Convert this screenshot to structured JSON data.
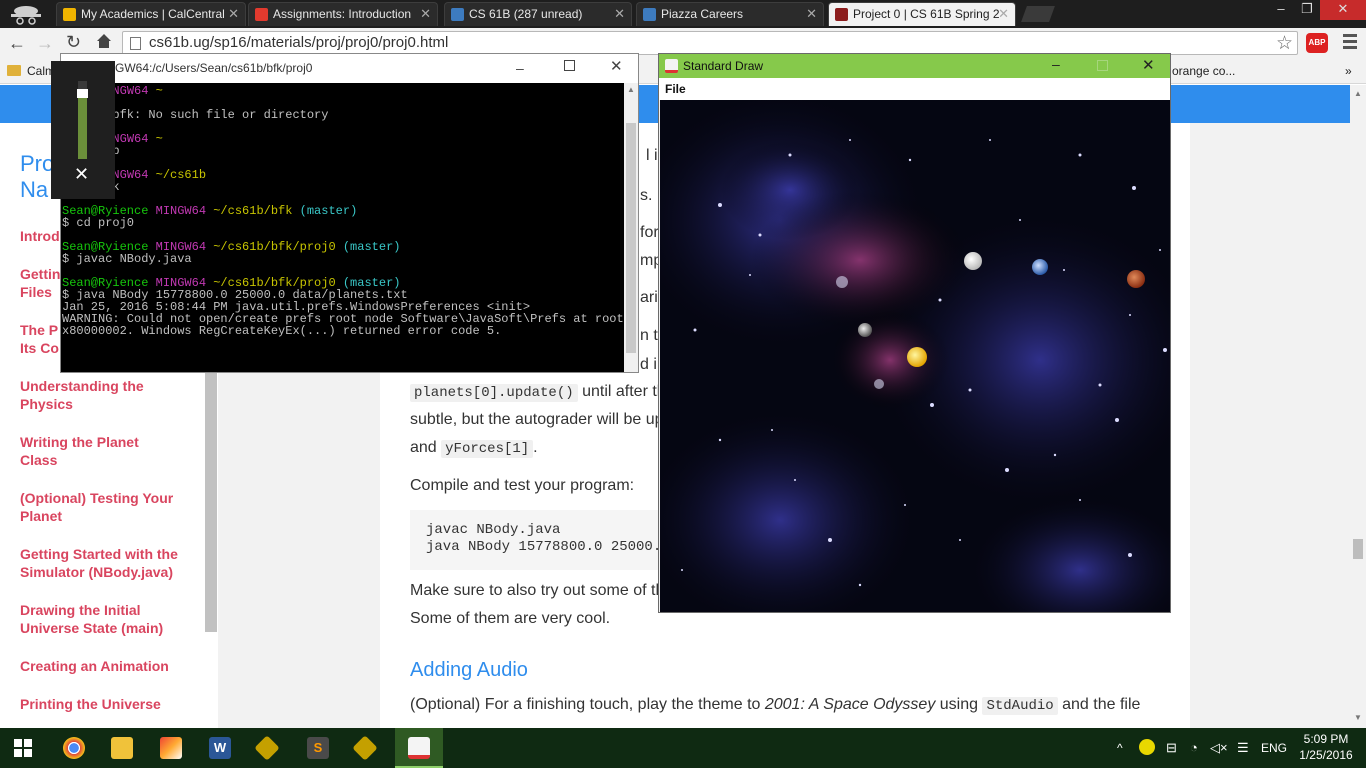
{
  "browser": {
    "tabs": [
      {
        "title": "My Academics | CalCentral",
        "icon_color": "#f0b400",
        "active": false
      },
      {
        "title": "Assignments: Introduction",
        "icon_color": "#e23a2e",
        "active": false
      },
      {
        "title": "CS 61B (287 unread)",
        "icon_color": "#3d7bbf",
        "active": false
      },
      {
        "title": "Piazza Careers",
        "icon_color": "#3d7bbf",
        "active": false
      },
      {
        "title": "Project 0 | CS 61B Spring 2",
        "icon_color": "#8c1d1d",
        "active": true
      }
    ],
    "url": "cs61b.ug/sp16/materials/proj/proj0/proj0.html",
    "bookmarks_left": "Calm",
    "bookmarks_right": "orange co...",
    "abp_label": "ABP"
  },
  "sidebar": {
    "title_line1": "Pro",
    "title_line2": "Na",
    "items": [
      {
        "label": "Introd"
      },
      {
        "label": "Gettin Files"
      },
      {
        "label": "The P Its Co"
      },
      {
        "label": "Understanding the Physics"
      },
      {
        "label": "Writing the Planet Class"
      },
      {
        "label": "(Optional) Testing Your Planet"
      },
      {
        "label": "Getting Started with the Simulator (NBody.java)"
      },
      {
        "label": "Drawing the Initial Universe State (main)"
      },
      {
        "label": "Creating an Animation"
      },
      {
        "label": "Printing the Universe"
      }
    ]
  },
  "content": {
    "frag1": "l in",
    "frag2": "s.",
    "frag3": "for",
    "frag4": "mp",
    "frag5": "aria",
    "frag6": "n th",
    "frag7": "d in",
    "update_code": "planets[0].update()",
    "update_after": "until after th",
    "subtle_line": "subtle, but the autograder will be up",
    "and_word": "and",
    "yforces_code": "yForces[1]",
    "period": ".",
    "compile_line": "Compile and test your program:",
    "code_lines": [
      "javac NBody.java",
      "java NBody 15778800.0 25000.("
    ],
    "make_sure": "Make sure to also try out some of th",
    "cool_line": "Some of them are very cool.",
    "heading_audio": "Adding Audio",
    "audio_line_pre": "(Optional) For a finishing touch, play the theme to ",
    "audio_line_em": "2001: A Space Odyssey",
    "audio_line_mid": " using ",
    "audio_code": "StdAudio",
    "audio_line_post": " and the file"
  },
  "terminal": {
    "title": "GW64:/c/Users/Sean/cs61b/bfk/proj0",
    "lines": [
      [
        {
          "t": "ence ",
          "c": "g"
        },
        {
          "t": "MINGW64 ",
          "c": "m"
        },
        {
          "t": "~",
          "c": "y"
        }
      ],
      [
        {
          "t": "    bfk",
          "c": ""
        }
      ],
      [
        {
          "t": "    d: bfk: No such file or directory",
          "c": ""
        }
      ],
      [
        {
          "t": "",
          "c": ""
        }
      ],
      [
        {
          "t": "ence ",
          "c": "g"
        },
        {
          "t": "MINGW64 ",
          "c": "m"
        },
        {
          "t": "~",
          "c": "y"
        }
      ],
      [
        {
          "t": "    s61b",
          "c": ""
        }
      ],
      [
        {
          "t": "",
          "c": ""
        }
      ],
      [
        {
          "t": "ence ",
          "c": "g"
        },
        {
          "t": "MINGW64 ",
          "c": "m"
        },
        {
          "t": "~/cs61b",
          "c": "y"
        }
      ],
      [
        {
          "t": "$ cd bfk",
          "c": ""
        }
      ],
      [
        {
          "t": "",
          "c": ""
        }
      ],
      [
        {
          "t": "Sean@Ryience ",
          "c": "g"
        },
        {
          "t": "MINGW64 ",
          "c": "m"
        },
        {
          "t": "~/cs61b/bfk ",
          "c": "y"
        },
        {
          "t": "(master)",
          "c": "c"
        }
      ],
      [
        {
          "t": "$ cd proj0",
          "c": ""
        }
      ],
      [
        {
          "t": "",
          "c": ""
        }
      ],
      [
        {
          "t": "Sean@Ryience ",
          "c": "g"
        },
        {
          "t": "MINGW64 ",
          "c": "m"
        },
        {
          "t": "~/cs61b/bfk/proj0 ",
          "c": "y"
        },
        {
          "t": "(master)",
          "c": "c"
        }
      ],
      [
        {
          "t": "$ javac NBody.java",
          "c": ""
        }
      ],
      [
        {
          "t": "",
          "c": ""
        }
      ],
      [
        {
          "t": "Sean@Ryience ",
          "c": "g"
        },
        {
          "t": "MINGW64 ",
          "c": "m"
        },
        {
          "t": "~/cs61b/bfk/proj0 ",
          "c": "y"
        },
        {
          "t": "(master)",
          "c": "c"
        }
      ],
      [
        {
          "t": "$ java NBody 15778800.0 25000.0 data/planets.txt",
          "c": ""
        }
      ],
      [
        {
          "t": "Jan 25, 2016 5:08:44 PM java.util.prefs.WindowsPreferences <init>",
          "c": ""
        }
      ],
      [
        {
          "t": "WARNING: Could not open/create prefs root node Software\\JavaSoft\\Prefs at root 0",
          "c": ""
        }
      ],
      [
        {
          "t": "x80000002. Windows RegCreateKeyEx(...) returned error code 5.",
          "c": ""
        }
      ]
    ]
  },
  "volume": {
    "level": 0.85
  },
  "stddraw": {
    "title": "Standard Draw",
    "menu_file": "File"
  },
  "taskbar": {
    "lang": "ENG",
    "time": "5:09 PM",
    "date": "1/25/2016"
  }
}
